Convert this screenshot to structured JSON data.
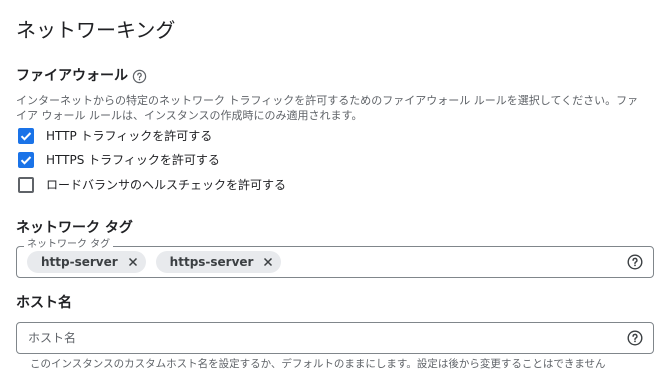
{
  "page": {
    "title": "ネットワーキング"
  },
  "firewall": {
    "title": "ファイアウォール",
    "help_icon": "help-circle-icon",
    "description": "インターネットからの特定のネットワーク トラフィックを許可するためのファイアウォール ルールを選択してください。ファイア ウォール ルールは、インスタンスの作成時にのみ適用されます。",
    "options": [
      {
        "label": "HTTP トラフィックを許可する",
        "checked": true
      },
      {
        "label": "HTTPS トラフィックを許可する",
        "checked": true
      },
      {
        "label": "ロードバランサのヘルスチェックを許可する",
        "checked": false
      }
    ]
  },
  "network_tags": {
    "title": "ネットワーク タグ",
    "field_label": "ネットワーク タグ",
    "chips": [
      "http-server",
      "https-server"
    ],
    "chip_close_icon": "close-icon",
    "help_icon": "help-circle-icon"
  },
  "hostname": {
    "title": "ホスト名",
    "placeholder": "ホスト名",
    "value": "",
    "help_icon": "help-circle-icon",
    "hint": "このインスタンスのカスタムホスト名を設定するか、デフォルトのままにします。設定は後から変更することはできません"
  },
  "colors": {
    "accent": "#1a73e8",
    "chip_bg": "#e8eaed",
    "border": "#80868b",
    "secondary_text": "#5f6368"
  }
}
